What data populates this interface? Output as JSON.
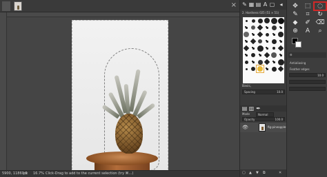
{
  "app": {
    "brand_accent": "#d32828"
  },
  "image_tabs": {
    "close_symbol": "×",
    "thumbnails": [
      "image-thumb-dark",
      "image-thumb-pineapple"
    ]
  },
  "status": {
    "coords": "5900, 11860.0",
    "unit": "px",
    "zoom": "16.7%",
    "message": "Click-Drag to add to the current selection (try ⌘...)"
  },
  "brushes": {
    "title": "2. Hardness 025 (51 × 51)",
    "tag_label": "Basic,",
    "spacing_label": "Spacing",
    "spacing_value": "10.0",
    "dock_icons": [
      "paintbrush-icon",
      "pattern-icon",
      "gradient-icon",
      "font-icon",
      "document-icon",
      "history-icon"
    ]
  },
  "tool_options": {
    "antialiasing": "Antialiasing",
    "feather_edges": "Feather edges",
    "radius_value": "10.0"
  },
  "layers": {
    "tabs": [
      "layers-icon",
      "channels-icon",
      "paths-icon"
    ],
    "mode_label": "Mode",
    "mode_value": "Normal",
    "opacity_label": "Opacity",
    "opacity_value": "100.0",
    "lock_label": "Lock:",
    "layer_name": "fig-pineapple-drinks",
    "eye_symbol": "👁"
  },
  "toolbox": {
    "tools": [
      {
        "name": "move-tool-icon",
        "glyph": "✥"
      },
      {
        "name": "rect-select-tool-icon",
        "glyph": "⬚"
      },
      {
        "name": "free-select-tool-icon",
        "glyph": "◌"
      },
      {
        "name": "paint-tool-icon",
        "glyph": "✎"
      },
      {
        "name": "crop-tool-icon",
        "glyph": "⌗"
      },
      {
        "name": "warp-tool-icon",
        "glyph": "↻"
      },
      {
        "name": "fill-tool-icon",
        "glyph": "◆"
      },
      {
        "name": "brush-tool-icon",
        "glyph": "🖌"
      },
      {
        "name": "eraser-tool-icon",
        "glyph": "⌫"
      },
      {
        "name": "clone-tool-icon",
        "glyph": "⊕"
      },
      {
        "name": "smudge-tool-icon",
        "glyph": "〰"
      },
      {
        "name": "text-tool-icon",
        "glyph": "A"
      },
      {
        "name": "zoom-tool-icon",
        "glyph": "🔍"
      },
      {
        "name": "measure-tool-icon",
        "glyph": "⊿"
      }
    ],
    "fg_color": "#000000",
    "bg_color": "#ffffff"
  }
}
